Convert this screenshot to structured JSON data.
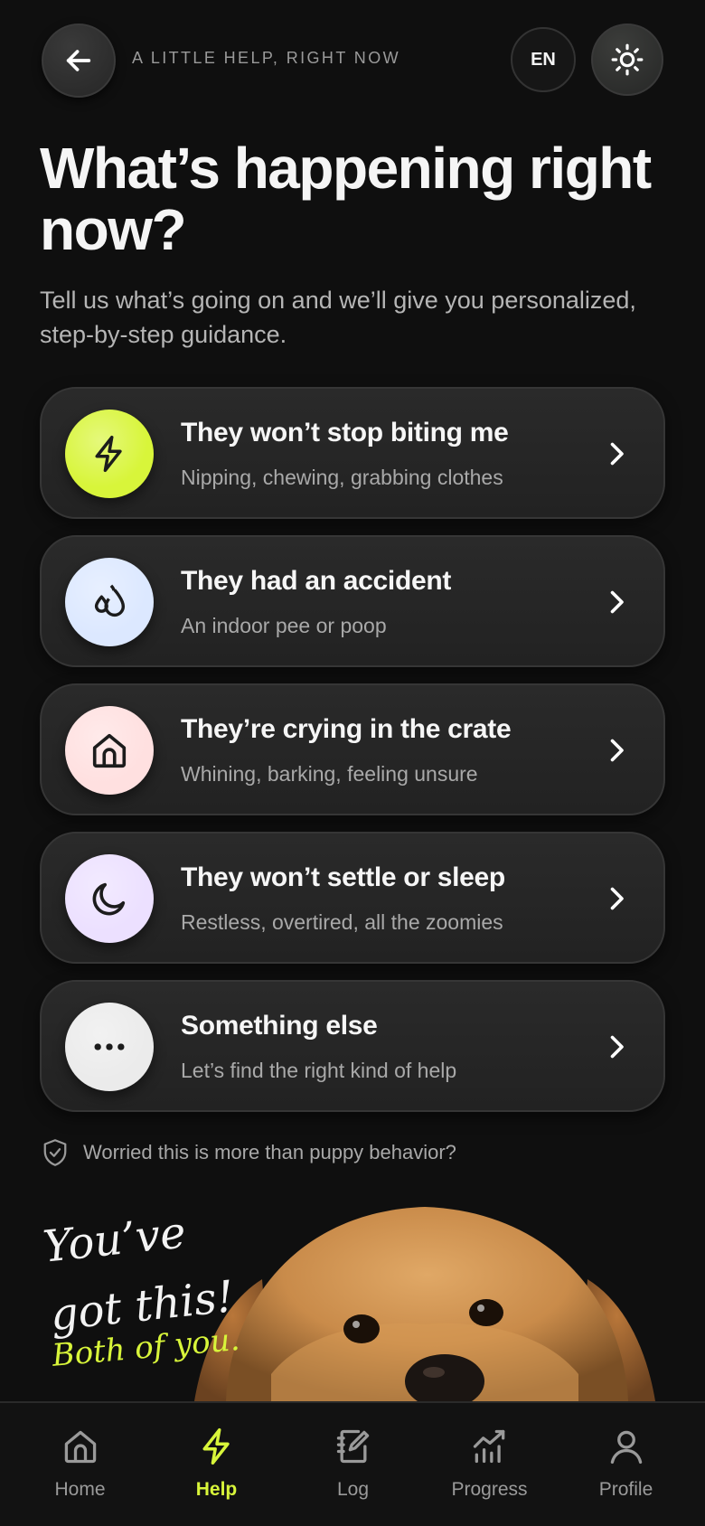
{
  "header": {
    "eyebrow": "A LITTLE HELP, RIGHT NOW",
    "lang": "EN",
    "back_icon": "arrow-left-icon",
    "theme_icon": "sun-icon"
  },
  "title": "What’s happening right now?",
  "subtitle": "Tell us what’s going on and we’ll give you personalized, step-by-step guidance.",
  "options": [
    {
      "title": "They won’t stop biting me",
      "sub": "Nipping, chewing, grabbing clothes",
      "icon": "lightning-icon",
      "bg": "#d8f53a"
    },
    {
      "title": "They had an accident",
      "sub": "An indoor pee or poop",
      "icon": "droplets-icon",
      "bg": "#dce8ff"
    },
    {
      "title": "They’re crying in the crate",
      "sub": "Whining, barking, feeling unsure",
      "icon": "home-icon",
      "bg": "#ffe0e0"
    },
    {
      "title": "They won’t settle or sleep",
      "sub": "Restless, overtired, all the zoomies",
      "icon": "moon-icon",
      "bg": "#ece0ff"
    },
    {
      "title": "Something else",
      "sub": "Let’s find the right kind of help",
      "icon": "more-dots-icon",
      "bg": "#ebebeb"
    }
  ],
  "worried": "Worried this is more than puppy behavior?",
  "hero": {
    "line1": "You’ve",
    "line2": "got this!",
    "line3": "Both of you."
  },
  "tabs": [
    {
      "label": "Home",
      "icon": "home-icon",
      "active": false
    },
    {
      "label": "Help",
      "icon": "lightning-icon",
      "active": true
    },
    {
      "label": "Log",
      "icon": "notebook-icon",
      "active": false
    },
    {
      "label": "Progress",
      "icon": "chart-icon",
      "active": false
    },
    {
      "label": "Profile",
      "icon": "user-icon",
      "active": false
    }
  ],
  "colors": {
    "accent": "#d8f53a",
    "background": "#0f0f0f",
    "card": "#262626"
  }
}
